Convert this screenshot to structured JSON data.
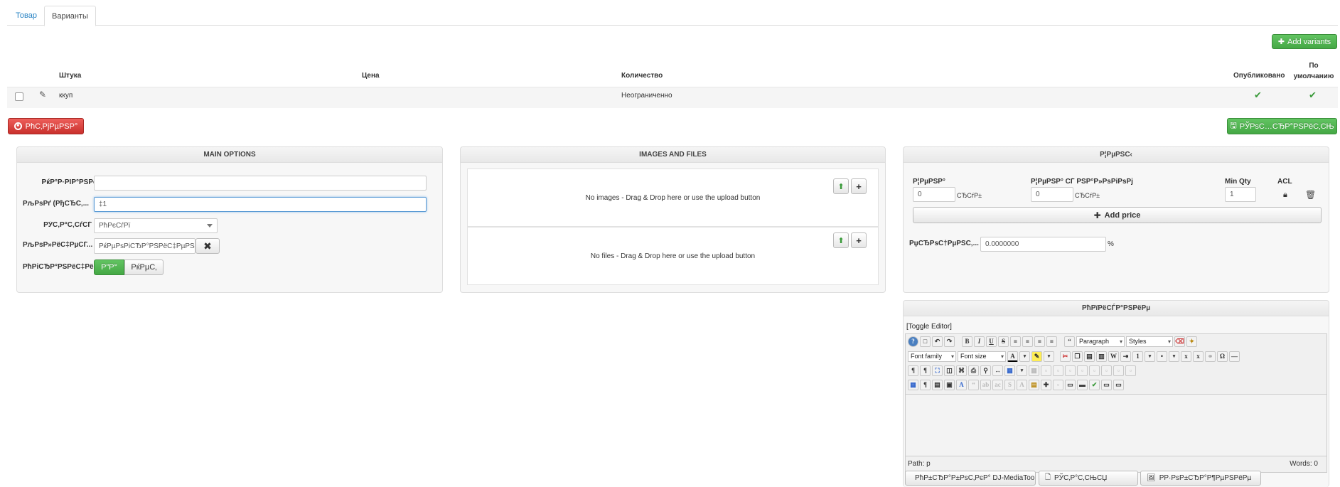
{
  "tabs": [
    {
      "label": "Товар"
    },
    {
      "label": "Варианты"
    }
  ],
  "toolbar": {
    "add_variants_label": "Add variants",
    "delete_label": "РћС‚РјРµРЅР°",
    "save_label": "РЎРѕС…СЂР°РЅРёС‚СЊ"
  },
  "variants_table": {
    "headers": [
      "Штука",
      "Цена",
      "Количество",
      "Опубликовано",
      "По умолчанию"
    ],
    "rows": [
      {
        "name": "ккуп",
        "price": "",
        "quantity": "Неограниченно"
      }
    ]
  },
  "main_options": {
    "title": "MAIN OPTIONS",
    "field1_label": "РќР°Р·РІР°РЅРёРµ",
    "field1_value": "",
    "field2_label": "РљРѕРґ (РђСЂС‚...",
    "field2_value": "‡1",
    "field3_label": "РЎС‚Р°С‚СѓСЃ",
    "field3_value": "РћРєСѓРї",
    "field4_label": "РљРѕР»РёС‡РµСЃ...",
    "field4_value": "РќРµРѕРіСЂР°РЅРёС‡РµРЅРЅРѕ",
    "field5_label": "РћРіСЂР°РЅРёС‡РёРІ...",
    "toggle_yes": "Р”Р°",
    "toggle_no": "РќРµС‚"
  },
  "images_files": {
    "title": "IMAGES AND FILES",
    "no_images": "No images - Drag & Drop here or use the upload button",
    "no_files": "No files - Drag & Drop here or use the upload button"
  },
  "prices": {
    "title": "Р¦РµРЅС‹",
    "col_price": "Р¦РµРЅР°",
    "col_price_tax": "Р¦РµРЅР° СЃ РЅР°Р»РѕРіРѕРј",
    "col_min_qty": "Min Qty",
    "col_acl": "ACL",
    "price_value": "0",
    "price_tax_value": "0",
    "currency": "СЂСѓР±",
    "min_qty_value": "1",
    "add_price_label": "Add price",
    "percent_label": "РџСЂРѕС†РµРЅС‚...",
    "percent_value": "0.0000000",
    "percent_sign": "%"
  },
  "description": {
    "title": "РћРїРёСЃР°РЅРёРµ",
    "toggle_editor": "[Toggle Editor]",
    "paragraph": "Paragraph",
    "styles": "Styles",
    "font_family": "Font family",
    "font_size": "Font size",
    "path": "Path: p",
    "words": "Words: 0",
    "btn_media": "РћР±СЂР°Р±РѕС‚РєР° DJ-MediaTools",
    "btn_article": "РЎС‚Р°С‚СЊСЏ",
    "btn_image": "РР·РѕР±СЂР°Р¶РµРЅРёРµ"
  },
  "colors": {
    "accent_green": "#5cb85c",
    "danger_red": "#d9534f",
    "link_blue": "#2a84c4"
  }
}
